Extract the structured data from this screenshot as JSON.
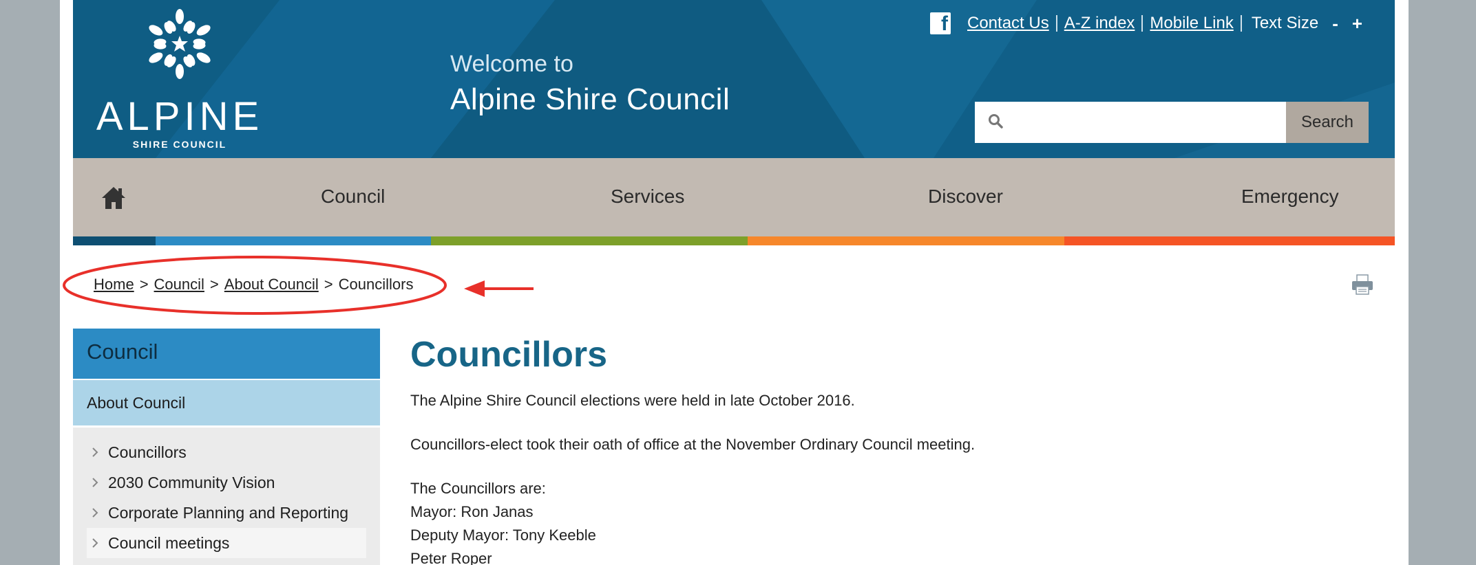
{
  "header": {
    "logo_word": "ALPINE",
    "logo_sub": "SHIRE COUNCIL",
    "welcome": "Welcome to",
    "council_name": "Alpine Shire Council",
    "links": [
      "Contact Us",
      "A-Z index",
      "Mobile Link"
    ],
    "text_size_label": "Text Size",
    "text_size_decrease": "-",
    "text_size_increase": "+",
    "search_button": "Search",
    "search_value": ""
  },
  "nav": {
    "items": [
      "Council",
      "Services",
      "Discover",
      "Emergency"
    ]
  },
  "colors": {
    "header_bg": "#11618a",
    "nav_bg": "#c2bab2",
    "bar": [
      "#0e4f72",
      "#2c8bc4",
      "#7da02a",
      "#f6872b",
      "#f55425"
    ],
    "accent_title": "#176587",
    "annotation": "#e8302a"
  },
  "breadcrumb": {
    "items": [
      "Home",
      "Council",
      "About Council"
    ],
    "current": "Councillors",
    "separator": ">"
  },
  "sidebar": {
    "heading": "Council",
    "subheading": "About Council",
    "items": [
      "Councillors",
      "2030 Community Vision",
      "Corporate Planning and Reporting",
      "Council meetings"
    ]
  },
  "main": {
    "title": "Councillors",
    "paragraphs": [
      "The Alpine Shire Council elections were held in late October 2016.",
      "Councillors-elect took their oath of office at the November Ordinary Council meeting.",
      "The Councillors are:",
      "Mayor: Ron Janas",
      "Deputy Mayor: Tony Keeble",
      "Peter Roper"
    ]
  }
}
